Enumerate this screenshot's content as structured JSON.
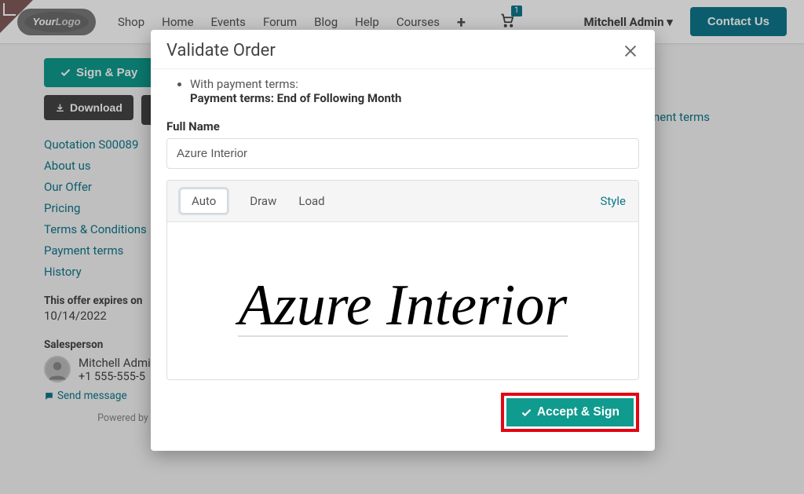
{
  "nav": {
    "links": [
      "Shop",
      "Home",
      "Events",
      "Forum",
      "Blog",
      "Help",
      "Courses"
    ],
    "cart_count": "1",
    "user": "Mitchell Admin ▾",
    "contact": "Contact Us"
  },
  "sidebar": {
    "sign_pay": "Sign & Pay",
    "download": "Download",
    "links": {
      "quotation": "Quotation S00089",
      "about": "About us",
      "offer": "Our Offer",
      "pricing": "Pricing",
      "terms": "Terms & Conditions",
      "pay_terms": "Payment terms",
      "history": "History"
    },
    "expires_label": "This offer expires on",
    "expires_date": "10/14/2022",
    "salesperson_label": "Salesperson",
    "sp_name": "Mitchell Admin",
    "sp_phone": "+1 555-555-5",
    "send_msg": "Send message",
    "powered": "Powered by Odoo"
  },
  "main_side_link": "Payment terms",
  "modal": {
    "title": "Validate Order",
    "terms_line": "With payment terms:",
    "terms_value": "Payment terms: End of Following Month",
    "full_name_label": "Full Name",
    "full_name_value": "Azure Interior",
    "tabs": {
      "auto": "Auto",
      "draw": "Draw",
      "load": "Load",
      "style": "Style"
    },
    "signature_text": "Azure Interior",
    "accept_label": "Accept & Sign"
  }
}
